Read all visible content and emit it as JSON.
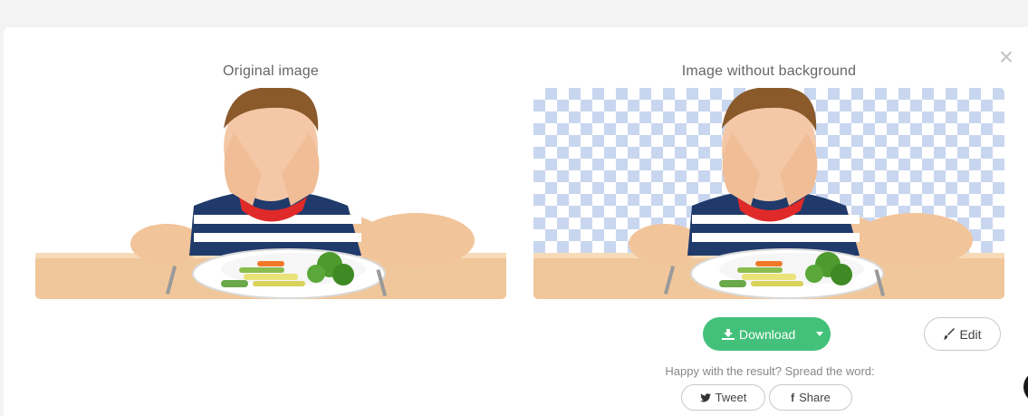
{
  "modal": {
    "close_label": "×"
  },
  "captions": {
    "original": "Original image",
    "result": "Image without background"
  },
  "actions": {
    "download_label": "Download",
    "download_icon": "download-tray-icon",
    "caret_icon": "caret-down-icon",
    "edit_label": "Edit",
    "edit_icon": "brush-icon"
  },
  "share": {
    "prompt": "Happy with the result? Spread the word:",
    "tweet_label": "Tweet",
    "tweet_icon": "twitter-bird-icon",
    "share_label": "Share",
    "share_icon": "facebook-f-icon"
  },
  "colors": {
    "download_green": "#43c17a",
    "checker_blue": "#c9d6ef",
    "table_wood": "#f0c79b"
  }
}
